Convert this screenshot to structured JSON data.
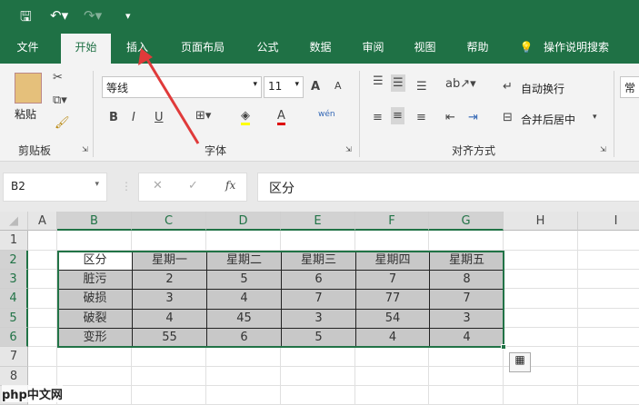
{
  "quick_access": {
    "save_icon": "save-icon",
    "undo_icon": "undo-icon",
    "redo_icon": "redo-icon",
    "customize_icon": "more-icon"
  },
  "tabs": [
    {
      "label": "文件"
    },
    {
      "label": "开始"
    },
    {
      "label": "插入"
    },
    {
      "label": "页面布局"
    },
    {
      "label": "公式"
    },
    {
      "label": "数据"
    },
    {
      "label": "审阅"
    },
    {
      "label": "视图"
    },
    {
      "label": "帮助"
    }
  ],
  "tell_me": "操作说明搜索",
  "ribbon": {
    "clipboard": {
      "paste": "粘贴",
      "group": "剪贴板"
    },
    "font": {
      "name": "等线",
      "size": "11",
      "group": "字体",
      "bold": "B",
      "italic": "I",
      "underline": "U",
      "grow": "A",
      "shrink": "A",
      "font_color": "A",
      "phonetic": "wén"
    },
    "alignment": {
      "wrap": "自动换行",
      "merge": "合并后居中",
      "group": "对齐方式"
    },
    "number": {
      "format": "常"
    }
  },
  "formula_bar": {
    "name_box": "B2",
    "cancel": "✕",
    "enter": "✓",
    "fx": "fx",
    "value": "区分"
  },
  "columns": [
    "A",
    "B",
    "C",
    "D",
    "E",
    "F",
    "G",
    "H",
    "I"
  ],
  "rows": [
    "1",
    "2",
    "3",
    "4",
    "5",
    "6",
    "7",
    "8",
    "9"
  ],
  "table": {
    "header": [
      "区分",
      "星期一",
      "星期二",
      "星期三",
      "星期四",
      "星期五"
    ],
    "body": [
      [
        "脏污",
        "2",
        "5",
        "6",
        "7",
        "8"
      ],
      [
        "破损",
        "3",
        "4",
        "7",
        "77",
        "7"
      ],
      [
        "破裂",
        "4",
        "45",
        "3",
        "54",
        "3"
      ],
      [
        "变形",
        "55",
        "6",
        "5",
        "4",
        "4"
      ]
    ]
  },
  "watermark": "php中文网",
  "colors": {
    "excel_green": "#1f7145",
    "selection": "#217346",
    "arrow": "#e03a3a"
  }
}
